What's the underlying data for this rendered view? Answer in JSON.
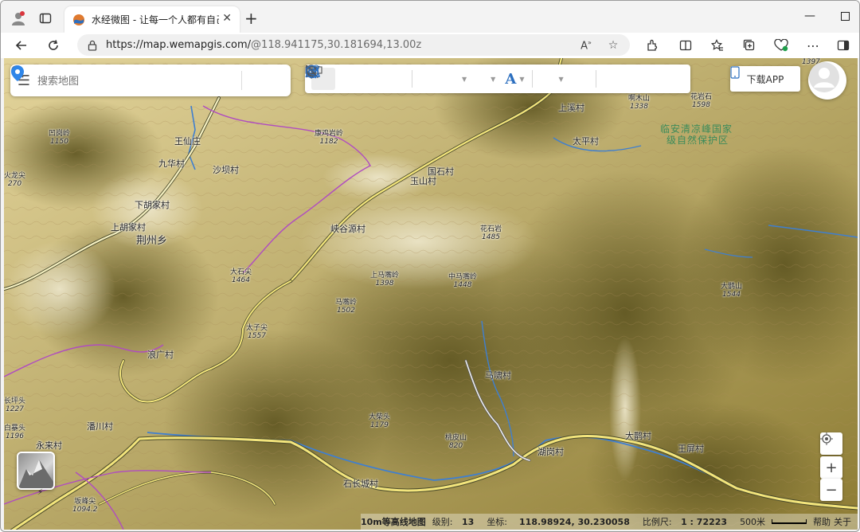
{
  "browser": {
    "tab_title": "水经微图 - 让每一个人都有自己的",
    "url_host": "https://map.wemapgis.com/",
    "url_path": "@118.941175,30.181694,13.00z"
  },
  "search": {
    "placeholder": "搜索地图"
  },
  "app_button": {
    "label": "下载APP"
  },
  "status": {
    "layer_name": "10m等高线地图",
    "zoom_label": "级别:",
    "zoom_value": "13",
    "coord_label": "坐标:",
    "coord_value": "118.98924, 30.230058",
    "scale_label": "比例尺:",
    "scale_value": "1 : 72223",
    "scale_bar": "500米",
    "help": "帮助",
    "about": "关于"
  },
  "places": {
    "wangxianzhuang": "王仙庄",
    "jiuhua": "九华村",
    "shaba": "沙坝村",
    "xiahujia": "下胡家村",
    "shanghujia": "上胡家村",
    "jingzhou": "荆州乡",
    "xiagu": "峡谷源村",
    "guoshi": "国石村",
    "yushan": "玉山村",
    "shangxi": "上溪村",
    "taiping": "太平村",
    "langguang": "浪广村",
    "panchuan": "潘川村",
    "yonglai": "永来村",
    "shichangcheng": "石长城村",
    "husi": "湖岗村",
    "daxi": "大鹊村",
    "wangping": "王屏村",
    "maxiao": "马啸村"
  },
  "reserve": {
    "line1": "临安清凉峰国家",
    "line2": "级自然保护区"
  },
  "peaks": {
    "p1150": {
      "name": "凹岗岭",
      "elev": "1150"
    },
    "p1182": {
      "name": "康鸡岩岭",
      "elev": "1182"
    },
    "p270": {
      "name": "火龙尖",
      "elev": "270"
    },
    "p1464": {
      "name": "大石尖",
      "elev": "1464"
    },
    "p1398": {
      "name": "上马嘴岭",
      "elev": "1398"
    },
    "p1448": {
      "name": "中马嘴岭",
      "elev": "1448"
    },
    "p1485": {
      "name": "花石岩",
      "elev": "1485"
    },
    "p1502": {
      "name": "马嘴岭",
      "elev": "1502"
    },
    "p1557": {
      "name": "太子尖",
      "elev": "1557"
    },
    "p1338": {
      "name": "啊木山",
      "elev": "1338"
    },
    "p1598": {
      "name": "花岩石",
      "elev": "1598"
    },
    "p1397": {
      "name": "",
      "elev": "1397"
    },
    "p1544": {
      "name": "大鹊山",
      "elev": "1544"
    },
    "p1179": {
      "name": "大柴头",
      "elev": "1179"
    },
    "p820": {
      "name": "桃皮山",
      "elev": "820"
    },
    "p1227": {
      "name": "长坪头",
      "elev": "1227"
    },
    "p1196": {
      "name": "白暴头",
      "elev": "1196"
    },
    "p1094": {
      "name": "坂峰尖",
      "elev": "1094.2"
    }
  }
}
